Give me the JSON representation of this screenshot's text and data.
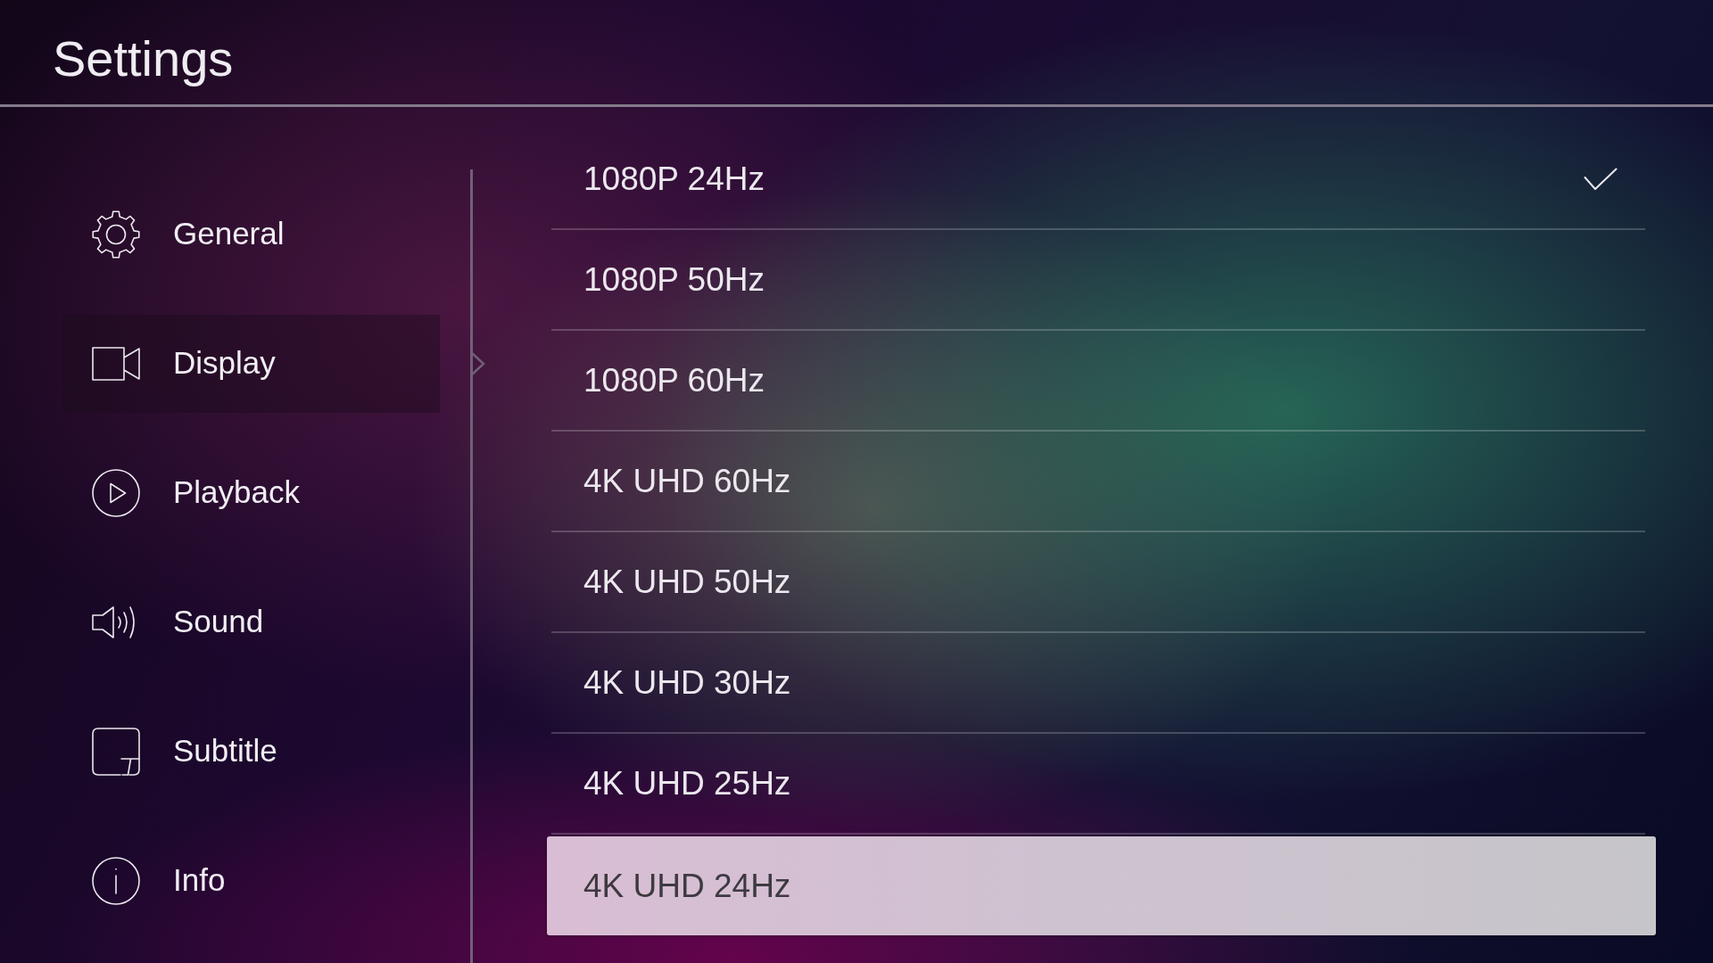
{
  "screen": {
    "title": "Settings"
  },
  "sidebar": {
    "items": [
      {
        "label": "General",
        "selected": false
      },
      {
        "label": "Display",
        "selected": true
      },
      {
        "label": "Playback",
        "selected": false
      },
      {
        "label": "Sound",
        "selected": false
      },
      {
        "label": "Subtitle",
        "selected": false
      },
      {
        "label": "Info",
        "selected": false
      }
    ]
  },
  "resolution_options": [
    {
      "label": "1080P 24Hz",
      "checked": true,
      "focused": false
    },
    {
      "label": "1080P 50Hz",
      "checked": false,
      "focused": false
    },
    {
      "label": "1080P 60Hz",
      "checked": false,
      "focused": false
    },
    {
      "label": "4K UHD 60Hz",
      "checked": false,
      "focused": false
    },
    {
      "label": "4K UHD 50Hz",
      "checked": false,
      "focused": false
    },
    {
      "label": "4K UHD 30Hz",
      "checked": false,
      "focused": false
    },
    {
      "label": "4K UHD 25Hz",
      "checked": false,
      "focused": false
    },
    {
      "label": "4K UHD 24Hz",
      "checked": false,
      "focused": true
    }
  ]
}
